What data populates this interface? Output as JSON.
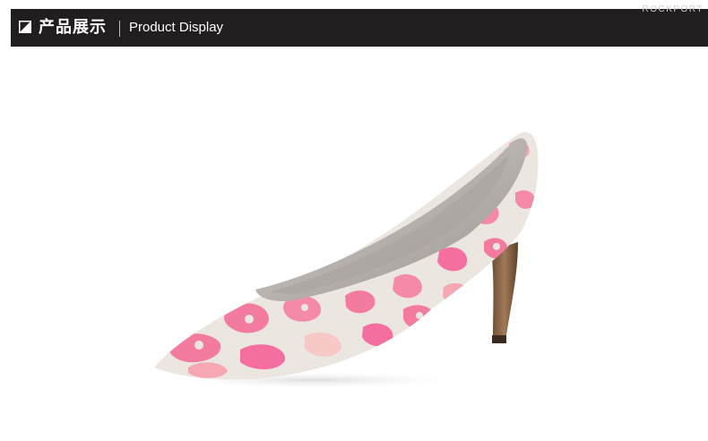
{
  "header": {
    "title_cn": "产品展示",
    "title_en": "Product Display",
    "brand": "ROCKPORT",
    "icon": "corner-square-icon"
  },
  "product": {
    "image": "pink-leopard-print-pointed-heel-pump",
    "print_colors": [
      "#f48aa8",
      "#f46fa0",
      "#f7c9c6",
      "#e8e4de"
    ],
    "heel_color": "#8a6446"
  }
}
